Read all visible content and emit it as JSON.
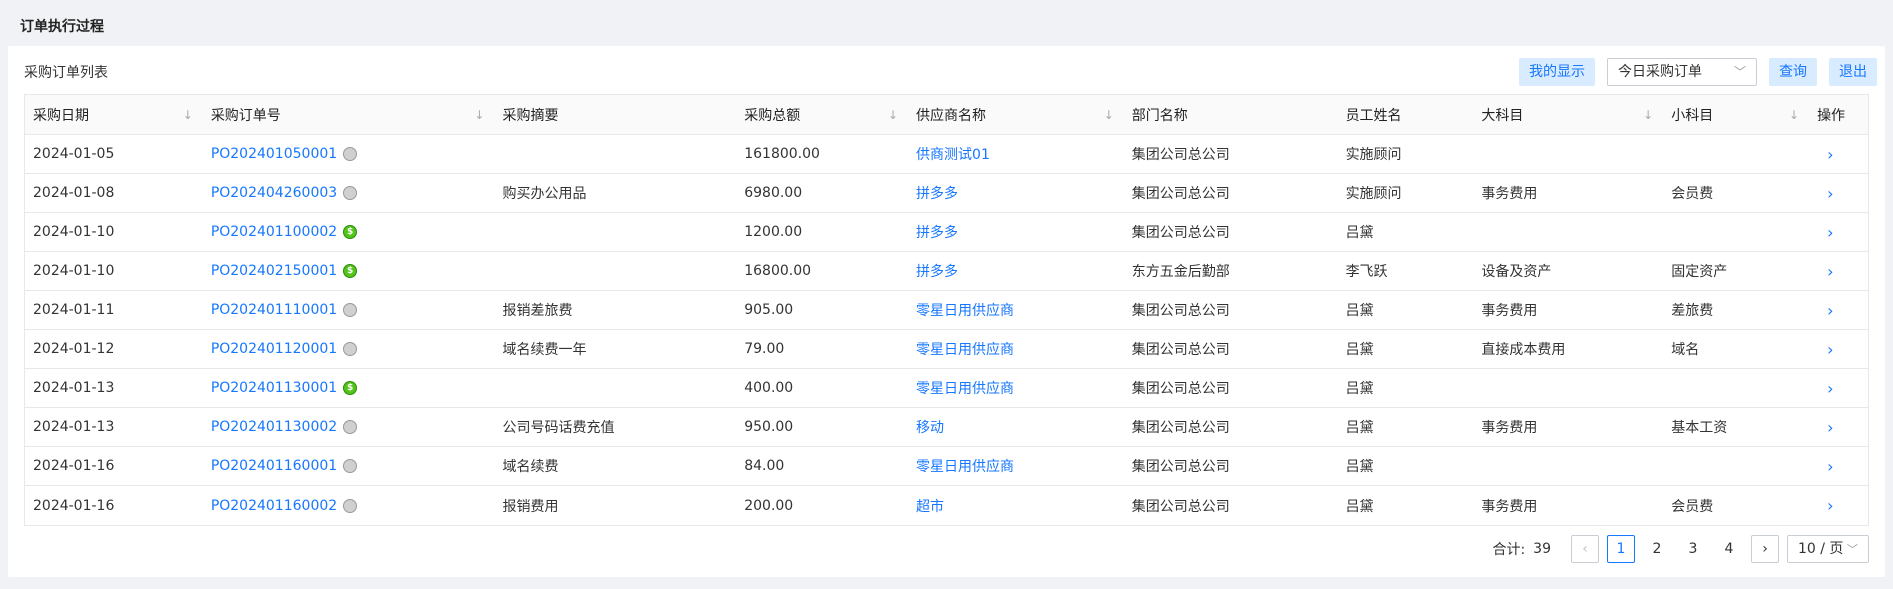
{
  "page": {
    "title": "订单执行过程"
  },
  "panel": {
    "list_title": "采购订单列表",
    "toolbar": {
      "my_display": "我的显示",
      "filter_value": "今日采购订单",
      "query": "查询",
      "exit": "退出"
    }
  },
  "table": {
    "headers": [
      "采购日期",
      "采购订单号",
      "采购摘要",
      "采购总额",
      "供应商名称",
      "部门名称",
      "员工姓名",
      "大科目",
      "小科目",
      "操作"
    ],
    "rows": [
      {
        "date": "2024-01-05",
        "order": "PO202401050001",
        "status": "grey",
        "summary": "",
        "amount": "161800.00",
        "supplier": "供商测试01",
        "dept": "集团公司总公司",
        "employee": "实施顾问",
        "major": "",
        "minor": ""
      },
      {
        "date": "2024-01-08",
        "order": "PO202404260003",
        "status": "grey",
        "summary": "购买办公用品",
        "amount": "6980.00",
        "supplier": "拼多多",
        "dept": "集团公司总公司",
        "employee": "实施顾问",
        "major": "事务费用",
        "minor": "会员费"
      },
      {
        "date": "2024-01-10",
        "order": "PO202401100002",
        "status": "green",
        "summary": "",
        "amount": "1200.00",
        "supplier": "拼多多",
        "dept": "集团公司总公司",
        "employee": "吕黛",
        "major": "",
        "minor": ""
      },
      {
        "date": "2024-01-10",
        "order": "PO202402150001",
        "status": "green",
        "summary": "",
        "amount": "16800.00",
        "supplier": "拼多多",
        "dept": "东方五金后勤部",
        "employee": "李飞跃",
        "major": "设备及资产",
        "minor": "固定资产"
      },
      {
        "date": "2024-01-11",
        "order": "PO202401110001",
        "status": "grey",
        "summary": "报销差旅费",
        "amount": "905.00",
        "supplier": "零星日用供应商",
        "dept": "集团公司总公司",
        "employee": "吕黛",
        "major": "事务费用",
        "minor": "差旅费"
      },
      {
        "date": "2024-01-12",
        "order": "PO202401120001",
        "status": "grey",
        "summary": "域名续费一年",
        "amount": "79.00",
        "supplier": "零星日用供应商",
        "dept": "集团公司总公司",
        "employee": "吕黛",
        "major": "直接成本费用",
        "minor": "域名"
      },
      {
        "date": "2024-01-13",
        "order": "PO202401130001",
        "status": "green",
        "summary": "",
        "amount": "400.00",
        "supplier": "零星日用供应商",
        "dept": "集团公司总公司",
        "employee": "吕黛",
        "major": "",
        "minor": ""
      },
      {
        "date": "2024-01-13",
        "order": "PO202401130002",
        "status": "grey",
        "summary": "公司号码话费充值",
        "amount": "950.00",
        "supplier": "移动",
        "dept": "集团公司总公司",
        "employee": "吕黛",
        "major": "事务费用",
        "minor": "基本工资"
      },
      {
        "date": "2024-01-16",
        "order": "PO202401160001",
        "status": "grey",
        "summary": "域名续费",
        "amount": "84.00",
        "supplier": "零星日用供应商",
        "dept": "集团公司总公司",
        "employee": "吕黛",
        "major": "",
        "minor": ""
      },
      {
        "date": "2024-01-16",
        "order": "PO202401160002",
        "status": "grey",
        "summary": "报销费用",
        "amount": "200.00",
        "supplier": "超市",
        "dept": "集团公司总公司",
        "employee": "吕黛",
        "major": "事务费用",
        "minor": "会员费"
      }
    ]
  },
  "pagination": {
    "total_label": "合计:",
    "total": "39",
    "pages": [
      "1",
      "2",
      "3",
      "4"
    ],
    "current": "1",
    "page_size": "10 / 页"
  },
  "colors": {
    "accent": "#1677ff",
    "status_green": "#52c41a",
    "status_grey": "#d0d0d0"
  },
  "icons": {
    "sort": "sort-down-icon",
    "row_action": "chevron-right-icon",
    "status_grey": "status-circle-icon",
    "status_green": "dollar-circle-icon"
  }
}
